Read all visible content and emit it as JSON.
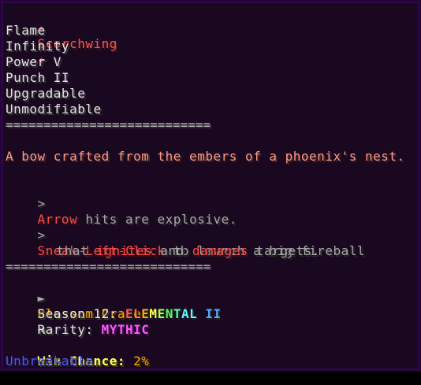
{
  "title": {
    "left_star": "✦",
    "name": "Scorchwing",
    "right_star": "✦"
  },
  "enchants": [
    "Flame",
    "Infinity",
    "Power V",
    "Punch II",
    "Upgradable",
    "Unmodifiable"
  ],
  "divider": "===========================",
  "description": "A bow crafted from the embers of a phoenix's nest.",
  "ability1": {
    "bullet": ">",
    "keyword": "Arrow",
    "text": " hits are explosive."
  },
  "ability2": {
    "bullet": ">",
    "keyword": "Sneak-Left-Click",
    "text": " to launch a big fireball",
    "line2_pre": "that ",
    "line2_kw1": "ignites",
    "line2_mid": " and ",
    "line2_kw2": "damages",
    "line2_post": " targets."
  },
  "crate": {
    "left_arrow": "►",
    "name": "Blossom Crate",
    "right_arrow": "◄"
  },
  "season": {
    "label": "Season 12: ",
    "value": "ELEMENTAL II"
  },
  "rarity": {
    "label": "Rarity: ",
    "value": "MYTHIC"
  },
  "win_chance": {
    "label": "Win Chance:",
    "value": " 2%"
  },
  "unbreakable": "Unbreakable",
  "colors": {
    "background": "#1a0820",
    "border": "#2a0b45",
    "title": "#ff5555",
    "lore": "#ff9a8a",
    "keyword": "#ff4b4b",
    "crate": "#ffaa00",
    "mythic": "#ff55ff",
    "win": "#ffff55",
    "unbreakable": "#5555ff"
  }
}
